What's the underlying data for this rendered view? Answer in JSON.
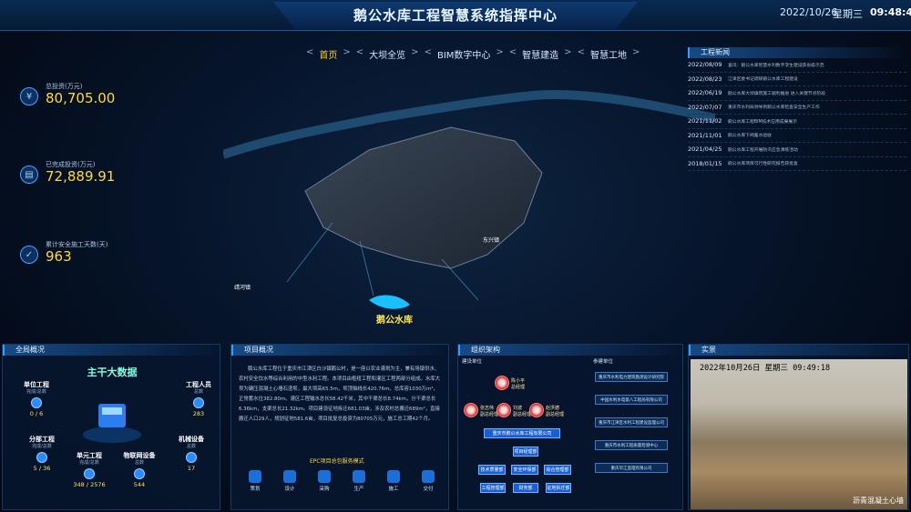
{
  "header": {
    "title": "鹅公水库工程智慧系统指挥中心",
    "date": "2022/10/26",
    "weekday": "星期三",
    "time": "09:48:43"
  },
  "nav": {
    "items": [
      {
        "label": "首页",
        "active": true
      },
      {
        "label": "大坝全览",
        "active": false
      },
      {
        "label": "BIM数字中心",
        "active": false
      },
      {
        "label": "智慧建造",
        "active": false
      },
      {
        "label": "智慧工地",
        "active": false
      }
    ]
  },
  "kpis": [
    {
      "label": "总投资(万元)",
      "value": "80,705.00",
      "icon": "money-icon"
    },
    {
      "label": "已完成投资(万元)",
      "value": "72,889.91",
      "icon": "document-icon"
    },
    {
      "label": "累计安全施工天数(天)",
      "value": "963",
      "icon": "shield-icon"
    }
  ],
  "map": {
    "labels": [
      "鹅公水库",
      "东兴镇",
      "靖河镇"
    ]
  },
  "news": {
    "title": "工程新闻",
    "items": [
      {
        "date": "2022/08/09",
        "text": "喜讯：鹅公水库智慧水利数字孪生建设获省级示范"
      },
      {
        "date": "2022/08/23",
        "text": "江津区委书记调研鹅公水库工程建设"
      },
      {
        "date": "2022/06/19",
        "text": "鹅公水库大坝填筑施工顺利推进 进入关键节点阶段"
      },
      {
        "date": "2022/07/07",
        "text": "重庆市水利局领导到鹅公水库检查安全生产工作"
      },
      {
        "date": "2021/11/02",
        "text": "鹅公水库工程BIM技术应用成果展示"
      },
      {
        "date": "2021/11/01",
        "text": "鹅公水库下闸蓄水验收"
      },
      {
        "date": "2021/04/25",
        "text": "鹅公水库工程开展防汛应急演练活动"
      },
      {
        "date": "2018/01/15",
        "text": "鹅公水库项目可行性研究报告获批复"
      }
    ]
  },
  "panels": {
    "overview": {
      "title": "全局概况",
      "big": "主干大数据",
      "nodes": [
        {
          "title": "单位工程",
          "sub": "完成/总数",
          "val": "0 / 6"
        },
        {
          "title": "工程人员",
          "sub": "总数",
          "val": "283"
        },
        {
          "title": "分部工程",
          "sub": "完成/总数",
          "val": "5 / 36"
        },
        {
          "title": "机械设备",
          "sub": "总数",
          "val": "17"
        },
        {
          "title": "单元工程",
          "sub": "完成/总数",
          "val": "348 / 2576"
        },
        {
          "title": "物联网设备",
          "sub": "总数",
          "val": "544"
        }
      ]
    },
    "project": {
      "title": "项目概况",
      "text": "鹅公水库工程位于重庆市江津区白沙镇鹅公村，是一座以农业灌溉为主，兼有场镇供水、农村安全饮水等综合利用的中型水利工程。本项目由枢纽工程和灌区工程两部分组成。水库大坝为碾压混凝土心墙石渣坝，最大坝高65.5m，坝顶轴线长420.76m。总库容1030万m³，正常蓄水位382.80m。灌区工程输水总长58.42千米，其中干渠总长8.74km，分干渠总长6.36km，支渠总长21.32km。项目建设征地拆迁681.03亩，涉及农村总搬迁689m²，直接搬迁人口29人，规划征地581.6亩，项目批复总投资为80705万元，施工总工期42个月。",
      "epc_title": "EPC项目总包服务模式",
      "epc": [
        "策划",
        "设计",
        "采购",
        "生产",
        "施工",
        "交付"
      ]
    },
    "org": {
      "title": "组织架构",
      "tab_left": "建设单位",
      "tab_right": "参建单位",
      "people": [
        {
          "name": "陈小平",
          "role": "总经理"
        },
        {
          "name": "张志伟",
          "role": "副总经理"
        },
        {
          "name": "刘波",
          "role": "副总经理"
        },
        {
          "name": "赵洪德",
          "role": "副总经理"
        }
      ],
      "company": "重庆市鹅公水库工程有限公司",
      "mid": "项目经理部",
      "depts": [
        "技术质量部",
        "安全环保部",
        "综合管理部"
      ],
      "depts2": [
        "工程管理部",
        "财务部",
        "征地拆迁部"
      ],
      "partners": [
        "重庆市水利电力建筑勘测设计研究院",
        "中国水利水电第八工程局有限公司",
        "重庆市江津区水利工程建设监理公司",
        "重庆市水利工程质量检测中心",
        "重庆华江监理有限公司"
      ]
    },
    "live": {
      "title": "实景",
      "timestamp": "2022年10月26日 星期三 09:49:18",
      "caption": "沥青混凝土心墙"
    }
  }
}
